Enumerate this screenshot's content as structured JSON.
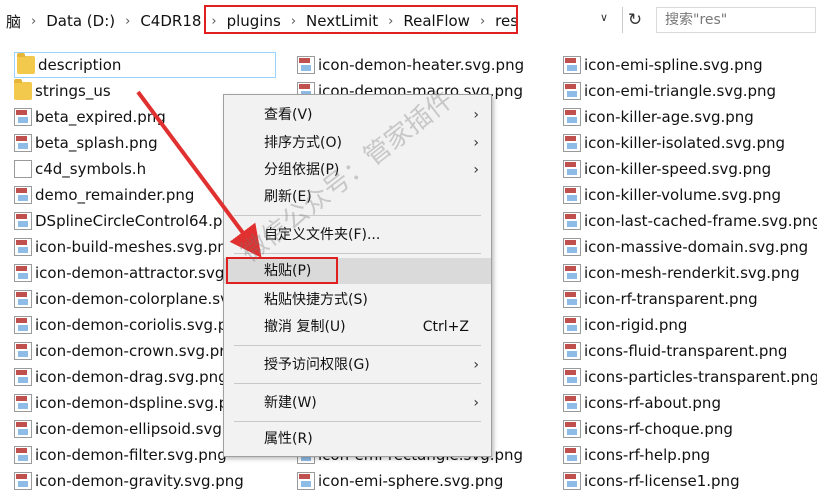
{
  "breadcrumb": [
    "脑",
    "Data (D:)",
    "C4DR18",
    "plugins",
    "NextLimit",
    "RealFlow",
    "res"
  ],
  "search_placeholder": "搜索\"res\"",
  "columns": [
    [
      "description",
      "strings_us",
      "beta_expired.png",
      "beta_splash.png",
      "c4d_symbols.h",
      "demo_remainder.png",
      "DSplineCircleControl64.pr",
      "icon-build-meshes.svg.pn",
      "icon-demon-attractor.svg",
      "icon-demon-colorplane.sv",
      "icon-demon-coriolis.svg.p",
      "icon-demon-crown.svg.pr",
      "icon-demon-drag.svg.png",
      "icon-demon-dspline.svg.p",
      "icon-demon-ellipsoid.svg",
      "icon-demon-filter.svg.png",
      "icon-demon-gravity.svg.png"
    ],
    [
      "icon-demon-heater.svg.png",
      "icon-demon-macro.svg.png",
      "png",
      "png",
      "png",
      "png",
      "png",
      "png",
      "",
      "",
      "",
      "",
      "png",
      "",
      "",
      "icon-emi-rectangle.svg.png",
      "icon-emi-sphere.svg.png"
    ],
    [
      "icon-emi-spline.svg.png",
      "icon-emi-triangle.svg.png",
      "icon-killer-age.svg.png",
      "icon-killer-isolated.svg.png",
      "icon-killer-speed.svg.png",
      "icon-killer-volume.svg.png",
      "icon-last-cached-frame.svg.png",
      "icon-massive-domain.svg.png",
      "icon-mesh-renderkit.svg.png",
      "icon-rf-transparent.png",
      "icon-rigid.png",
      "icons-fluid-transparent.png",
      "icons-particles-transparent.png",
      "icons-rf-about.png",
      "icons-rf-choque.png",
      "icons-rf-help.png",
      "icons-rf-license1.png"
    ]
  ],
  "menu": {
    "view": "查看(V)",
    "sort": "排序方式(O)",
    "group": "分组依据(P)",
    "refresh": "刷新(E)",
    "customize": "自定义文件夹(F)...",
    "paste": "粘贴(P)",
    "paste_shortcut": "粘贴快捷方式(S)",
    "undo": "撤消 复制(U)",
    "undo_key": "Ctrl+Z",
    "access": "授予访问权限(G)",
    "new": "新建(W)",
    "properties": "属性(R)"
  },
  "watermark": "微信公众号：管家插件",
  "colors": {
    "highlight": "#e02020",
    "folder": "#f2c94c"
  }
}
